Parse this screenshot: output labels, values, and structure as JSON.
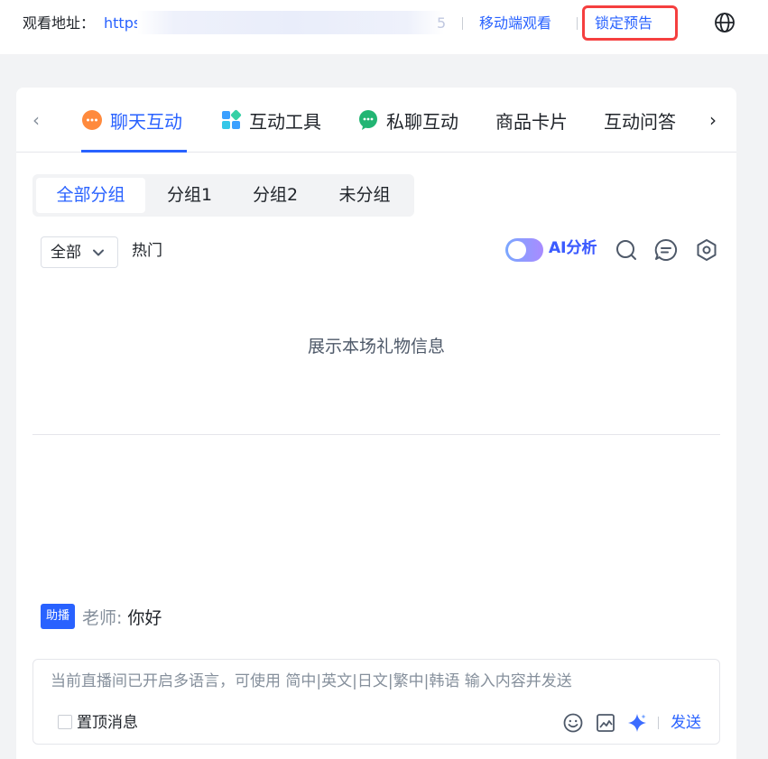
{
  "topbar": {
    "watch_label": "观看地址：",
    "url_visible": "https",
    "url_end": "5",
    "mobile_link": "移动端观看",
    "lock_preview_link": "锁定预告",
    "globe_icon": "globe-icon"
  },
  "tabs": {
    "items": [
      {
        "label": "聊天互动",
        "icon": "chat-bubble-icon",
        "active": true
      },
      {
        "label": "互动工具",
        "icon": "grid-tools-icon"
      },
      {
        "label": "私聊互动",
        "icon": "private-chat-icon"
      },
      {
        "label": "商品卡片"
      },
      {
        "label": "互动问答"
      }
    ],
    "prev_arrow": "‹",
    "next_arrow": "›"
  },
  "groups": {
    "items": [
      "全部分组",
      "分组1",
      "分组2",
      "未分组"
    ],
    "active_index": 0
  },
  "filter": {
    "select_value": "全部",
    "hot_label": "热门",
    "ai_label": "AI分析",
    "ai_toggle_on": true
  },
  "content": {
    "gift_info": "展示本场礼物信息"
  },
  "message": {
    "role": "助播",
    "sender": "老师:",
    "text": "你好"
  },
  "input": {
    "placeholder": "当前直播间已开启多语言，可使用 简中|英文|日文|繁中|韩语 输入内容并发送",
    "pin_label": "置顶消息",
    "send_label": "发送"
  },
  "colors": {
    "accent": "#2962ff",
    "highlight_border": "#f53f3f"
  }
}
